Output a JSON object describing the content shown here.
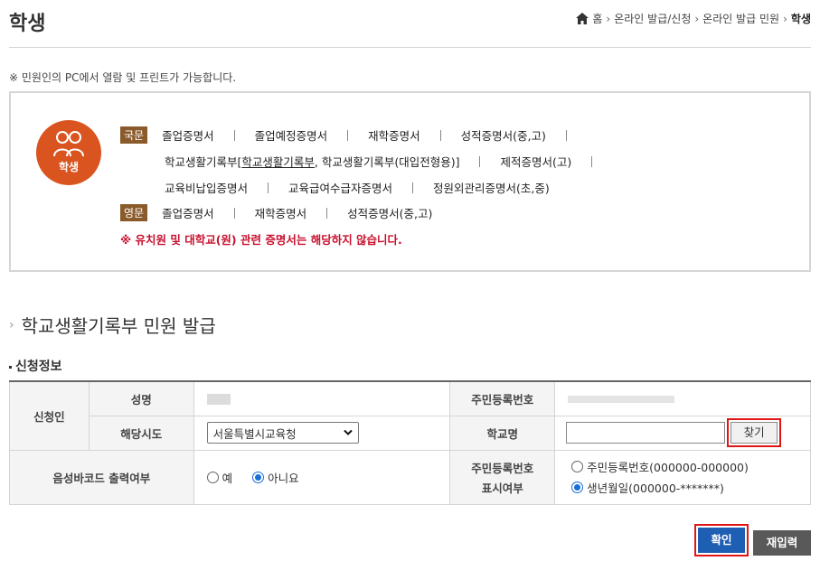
{
  "header": {
    "title": "학생",
    "breadcrumb": [
      "홈",
      "온라인 발급/신청",
      "온라인 발급 민원",
      "학생"
    ]
  },
  "notice": "※ 민원인의 PC에서 열람 및 프린트가 가능합니다.",
  "badge": {
    "label": "학생",
    "color": "#d9541f"
  },
  "certificates": {
    "korean_tag": "국문",
    "english_tag": "영문",
    "row1": [
      "졸업증명서",
      "졸업예정증명서",
      "재학증명서",
      "성적증명서(중,고)"
    ],
    "row2_prefix": "학교생활기록부[",
    "row2_link": "학교생활기록부",
    "row2_suffix": ", 학교생활기록부(대입전형용)]",
    "row2_last": "제적증명서(고)",
    "row3": [
      "교육비납입증명서",
      "교육급여수급자증명서",
      "정원외관리증명서(초,중)"
    ],
    "english": [
      "졸업증명서",
      "재학증명서",
      "성적증명서(중,고)"
    ],
    "warning": "※ 유치원 및 대학교(원) 관련 증명서는 해당하지 않습니다."
  },
  "section_title": "학교생활기록부 민원 발급",
  "sub_title": "신청정보",
  "form": {
    "applicant_label": "신청인",
    "name_label": "성명",
    "rrn_label": "주민등록번호",
    "region_label": "해당시도",
    "region_value": "서울특별시교육청",
    "school_label": "학교명",
    "school_value": "",
    "find_label": "찾기",
    "barcode_label": "음성바코드 출력여부",
    "barcode_yes": "예",
    "barcode_no": "아니요",
    "barcode_selected": "아니요",
    "rrn_display_label_1": "주민등록번호",
    "rrn_display_label_2": "표시여부",
    "rrn_option_full": "주민등록번호(000000-000000)",
    "rrn_option_birth": "생년월일(000000-*******)",
    "rrn_display_selected": "생년월일(000000-*******)"
  },
  "buttons": {
    "confirm": "확인",
    "reset": "재입력"
  },
  "colors": {
    "accent_blue": "#1f5fb3",
    "highlight_red": "#e01515",
    "warning_red": "#c8102e",
    "tag_brown": "#8b5a2b"
  }
}
